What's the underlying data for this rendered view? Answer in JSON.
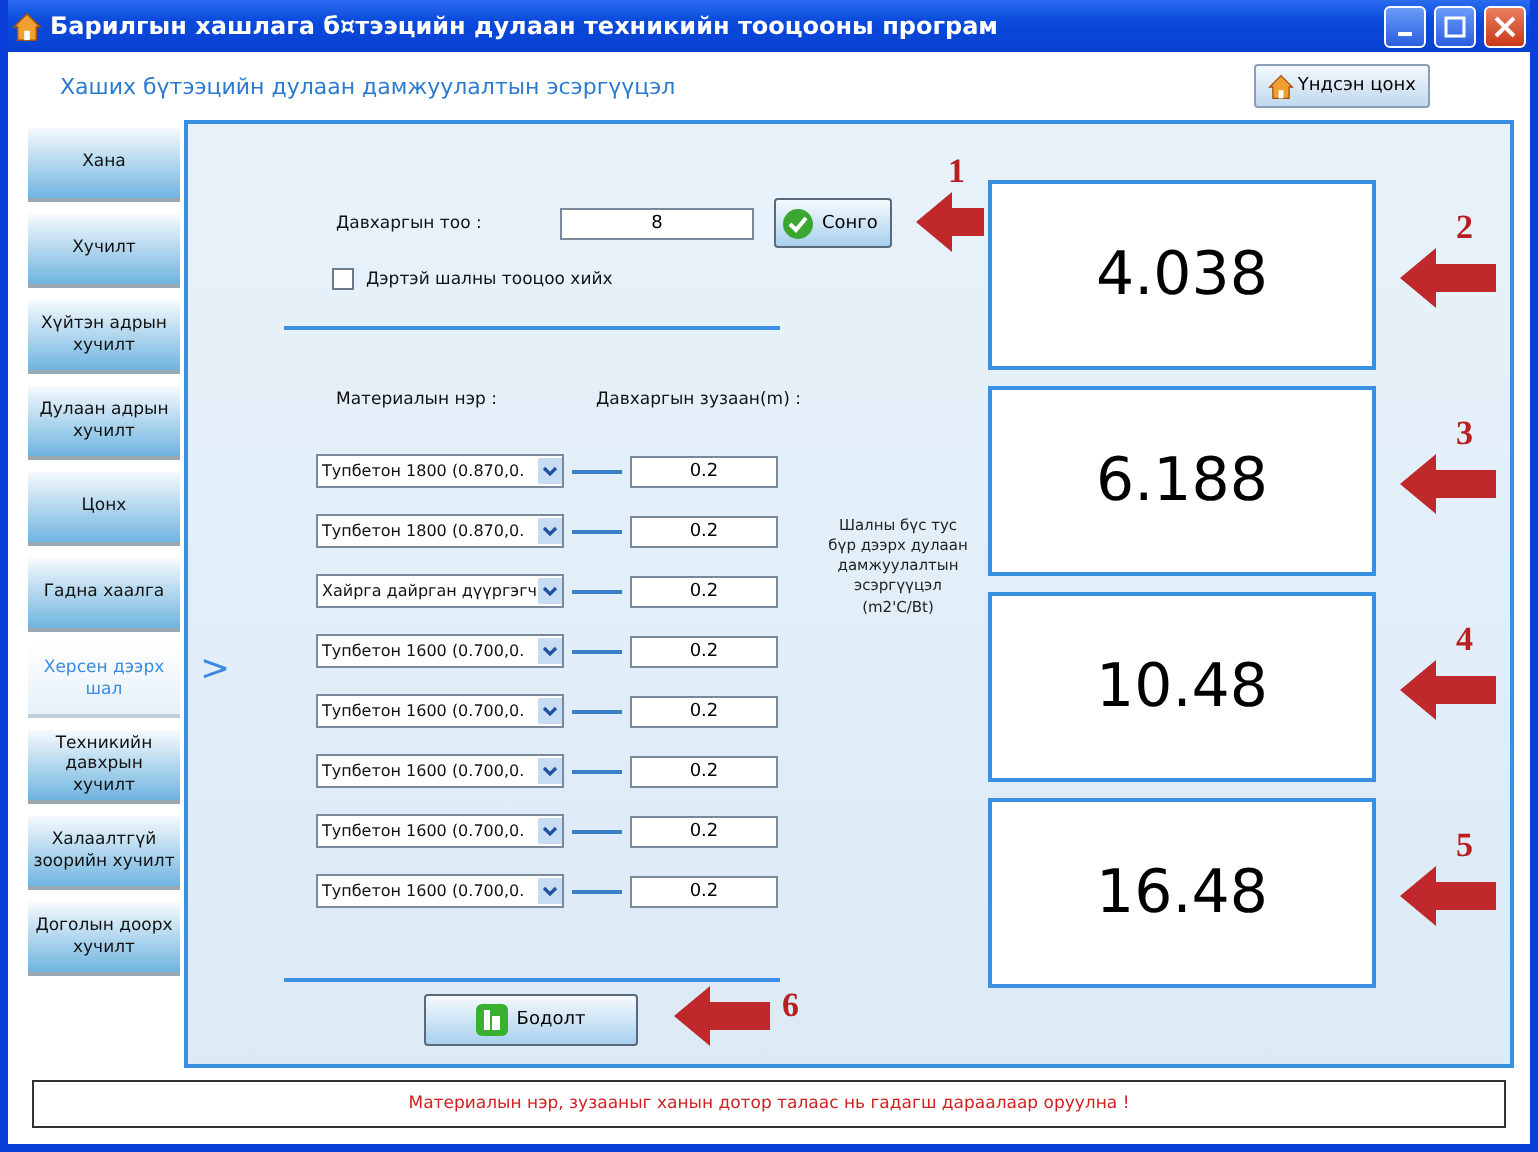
{
  "window": {
    "title": "Барилгын хашлага б¤тээцийн дулаан техникийн тооцооны програм"
  },
  "header": {
    "subtitle": "Хаших бүтээцийн дулаан дамжуулалтын эсэргүүцэл",
    "home_button": "Үндсэн цонх"
  },
  "sidebar": {
    "items": [
      {
        "label": "Хана",
        "selected": false
      },
      {
        "label": "Хучилт",
        "selected": false
      },
      {
        "label": "Хүйтэн адрын хучилт",
        "selected": false
      },
      {
        "label": "Дулаан адрын хучилт",
        "selected": false
      },
      {
        "label": "Цонх",
        "selected": false
      },
      {
        "label": "Гадна хаалга",
        "selected": false
      },
      {
        "label": "Херсен дээрх шал",
        "selected": true
      },
      {
        "label": "Техникийн давхрын хучилт",
        "selected": false
      },
      {
        "label": "Халаалтгүй зоорийн хучилт",
        "selected": false
      },
      {
        "label": "Доголын доорх хучилт",
        "selected": false
      }
    ],
    "pointer": ">"
  },
  "form": {
    "count_label": "Давхаргын тоо :",
    "count_value": "8",
    "select_button": {
      "label": "Сонго",
      "callout": "1"
    },
    "checkbox": {
      "label": "Дэртэй шалны тооцоо хийх",
      "checked": false
    },
    "material_header": "Материалын нэр :",
    "thickness_header": "Давхаргын зузаан(m) :",
    "layers": [
      {
        "material": "Тупбетон 1800 (0.870,0.",
        "thickness": "0.2"
      },
      {
        "material": "Тупбетон 1800 (0.870,0.",
        "thickness": "0.2"
      },
      {
        "material": "Хайрга дайрган дүүргэгч",
        "thickness": "0.2"
      },
      {
        "material": "Тупбетон 1600 (0.700,0.",
        "thickness": "0.2"
      },
      {
        "material": "Тупбетон 1600 (0.700,0.",
        "thickness": "0.2"
      },
      {
        "material": "Тупбетон 1600 (0.700,0.",
        "thickness": "0.2"
      },
      {
        "material": "Тупбетон 1600 (0.700,0.",
        "thickness": "0.2"
      },
      {
        "material": "Тупбетон 1600 (0.700,0.",
        "thickness": "0.2"
      }
    ],
    "compute_button": {
      "label": "Бодолт",
      "callout": "6"
    }
  },
  "results_label": "Шалны бүс тус бүр дээрх дулаан дамжуулалтын эсэргүүцэл (m2'C/Bt)",
  "results": [
    {
      "value": "4.038",
      "callout": "2"
    },
    {
      "value": "6.188",
      "callout": "3"
    },
    {
      "value": "10.48",
      "callout": "4"
    },
    {
      "value": "16.48",
      "callout": "5"
    }
  ],
  "status_bar": "Материалын нэр, зузааныг ханын дотор талаас нь гадагш дараалаар оруулна !"
}
